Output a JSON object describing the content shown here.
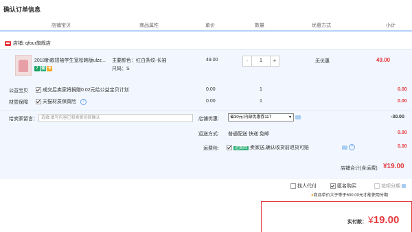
{
  "page_title": "确认订单信息",
  "table_headers": {
    "item": "店铺宝贝",
    "props": "商品属性",
    "price": "单价",
    "qty": "数量",
    "discount": "优惠方式",
    "subtotal": "小计"
  },
  "store": {
    "prefix": "店铺:",
    "name": "qfour旗舰店"
  },
  "product": {
    "name": "2018新款短袖学生宽松韩版ulzz...",
    "color_label": "主要颜色：红白条纹-长袖",
    "size_label": "尺码：S",
    "price": "49.00",
    "qty": "1",
    "qty_minus": "-",
    "qty_plus": "+",
    "discount": "无优惠",
    "subtotal": "49.00",
    "badges": [
      "7",
      "保",
      "卡"
    ]
  },
  "charity": {
    "label": "公益宝贝",
    "text": "成交后卖家将捐赠0.02元给公益宝贝计划",
    "price": "0.00",
    "qty": "1",
    "subtotal": "0.00"
  },
  "material": {
    "label": "材质保障",
    "text": "天猫材质保真险",
    "help": "?",
    "price": "0.00",
    "qty": "1",
    "subtotal": "0.00"
  },
  "message": {
    "label": "给卖家留言：",
    "placeholder": "选填:填写内容已和卖家协商确认"
  },
  "coupon": {
    "label": "店铺优惠:",
    "selected": "省30元:内部优惠券11T",
    "amount": "-30.00"
  },
  "shipping": {
    "label": "运送方式:",
    "text": "普通配送 快递 免邮",
    "amount": "0.00"
  },
  "freight_insurance": {
    "label": "运费险:",
    "tag": "运费险",
    "text": "卖家送,确认收货前退货可赔",
    "amount": "0.00"
  },
  "store_total": {
    "label": "店铺合计(含运费)",
    "amount": "¥19.00"
  },
  "options": {
    "proxy_pay": "找人代付",
    "anonymous": "匿名购买",
    "installment": "花呗分期",
    "installment_note": "商品单价大于等于600.00元才能使用分期"
  },
  "payment": {
    "label": "实付款：",
    "currency": "¥",
    "amount": "19.00"
  },
  "colors": {
    "accent": "#e4393c",
    "header_line": "#b2d1ff",
    "row_bg": "#f2f7ff",
    "badge_green": "#1aa260",
    "badge_teal": "#31b07a",
    "badge_orange": "#f5a623"
  }
}
